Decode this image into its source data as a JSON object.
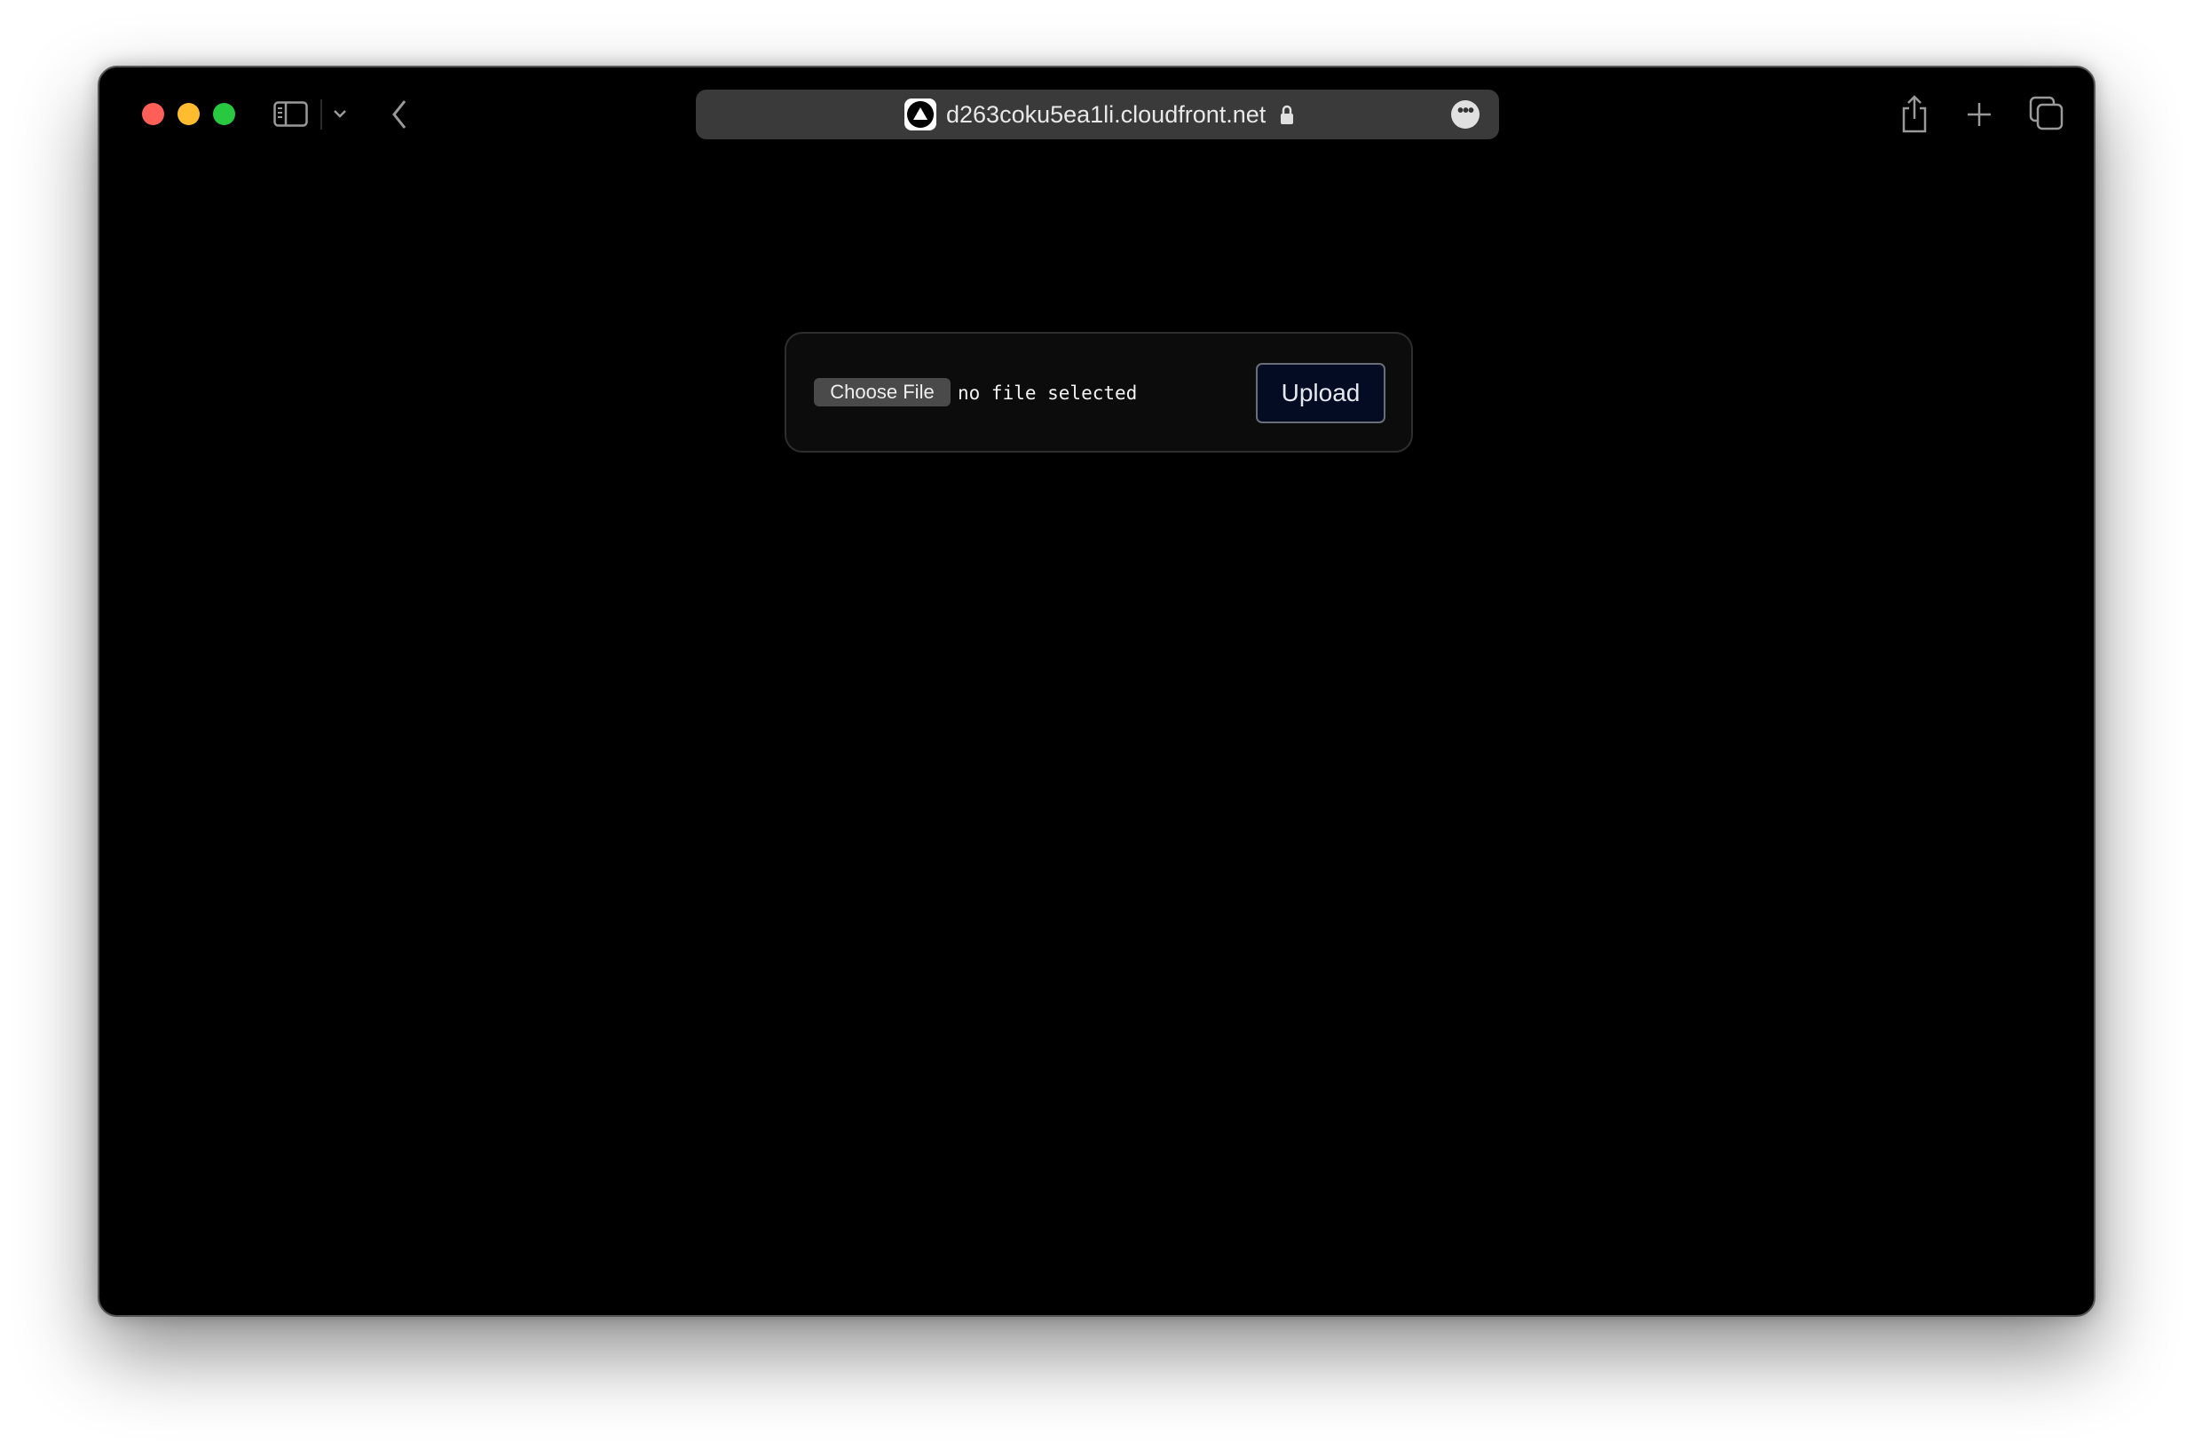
{
  "browser": {
    "url": "d263coku5ea1li.cloudfront.net",
    "icons": [
      "close-light",
      "minimize-light",
      "maximize-light",
      "sidebar-icon",
      "chevron-down-icon",
      "back-icon",
      "favicon",
      "lock-icon",
      "more-icon",
      "share-icon",
      "plus-icon",
      "tabs-icon"
    ]
  },
  "colors": {
    "close": "#ff5f57",
    "minimize": "#febc2e",
    "maximize": "#28c840",
    "upload_bg": "#040c24"
  },
  "form": {
    "choose_file_label": "Choose File",
    "file_status": "no file selected",
    "upload_label": "Upload"
  }
}
